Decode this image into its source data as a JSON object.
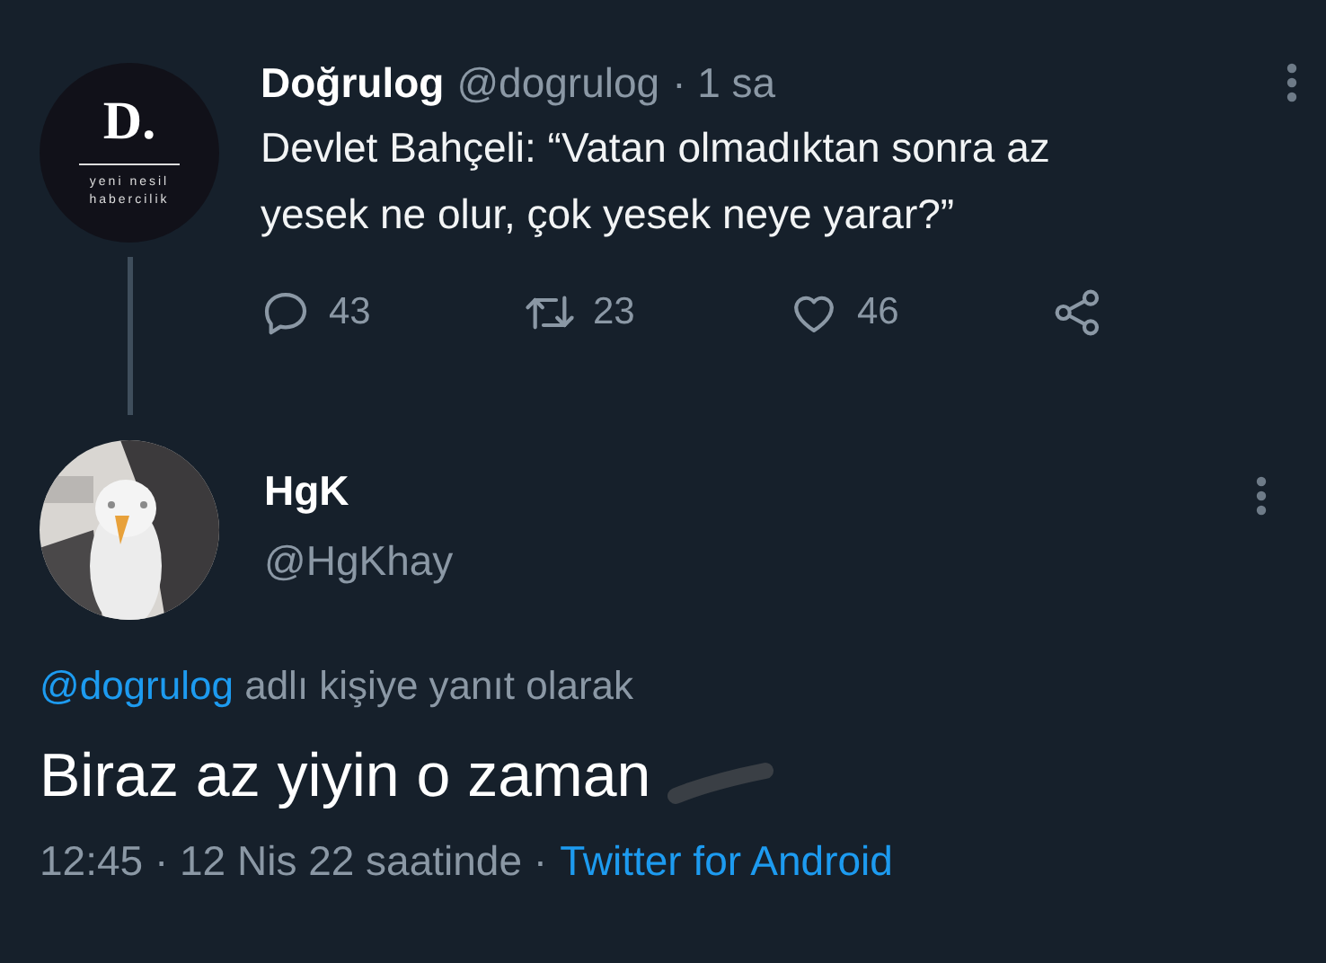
{
  "parent_tweet": {
    "avatar": {
      "letter": "D.",
      "tagline_1": "yeni nesil",
      "tagline_2": "habercilik"
    },
    "name": "Doğrulog",
    "handle": "@dogrulog",
    "time": "· 1 sa",
    "text": "Devlet Bahçeli: “Vatan olmadıktan sonra az yesek ne olur, çok yesek neye yarar?”",
    "actions": [
      {
        "kind": "reply",
        "count": "43"
      },
      {
        "kind": "retweet",
        "count": "23"
      },
      {
        "kind": "like",
        "count": "46"
      },
      {
        "kind": "share"
      }
    ]
  },
  "reply_tweet": {
    "name": "HgK",
    "handle": "@HgKhay",
    "reply_to": {
      "mention": "@dogrulog",
      "text": "adlı kişiye yanıt olarak"
    },
    "text": "Biraz az yiyin o zaman",
    "time": "12:45 · 12 Nis 22 saatinde ·",
    "source": "Twitter for Android"
  }
}
